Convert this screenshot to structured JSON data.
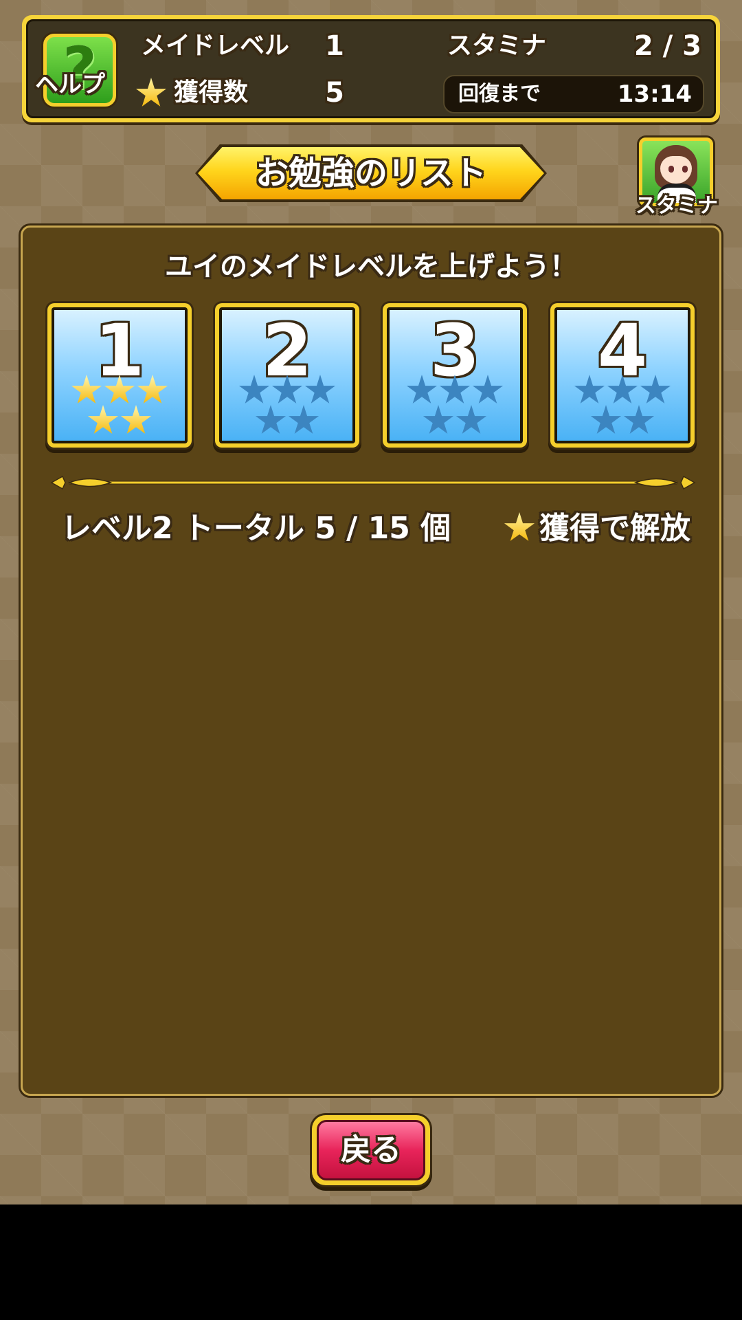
{
  "header": {
    "help_label": "ヘルプ",
    "help_glyph": "?",
    "maid_level_label": "メイドレベル",
    "maid_level_value": "1",
    "stamina_label": "スタミナ",
    "stamina_value": "2 / 3",
    "acquired_label": "獲得数",
    "acquired_value": "5",
    "recovery_label": "回復まで",
    "recovery_time": "13:14"
  },
  "title": "お勉強のリスト",
  "stamina_button": {
    "label": "スタミナ"
  },
  "main": {
    "heading": "ユイのメイドレベルを上げよう！",
    "levels": [
      {
        "number": "1",
        "stars_earned": 5,
        "stars_total": 5
      },
      {
        "number": "2",
        "stars_earned": 0,
        "stars_total": 5
      },
      {
        "number": "3",
        "stars_earned": 0,
        "stars_total": 5
      },
      {
        "number": "4",
        "stars_earned": 0,
        "stars_total": 5
      }
    ],
    "progress": "レベル2 トータル 5 / 15 個",
    "unlock": "獲得で解放"
  },
  "back_button": {
    "label": "戻る"
  },
  "colors": {
    "gold": "#f5cf2c",
    "panel": "#5a4416",
    "tile_blue": "#4ab2f5",
    "star_unearned": "#3c85c0",
    "back_button": "#e8245a"
  }
}
